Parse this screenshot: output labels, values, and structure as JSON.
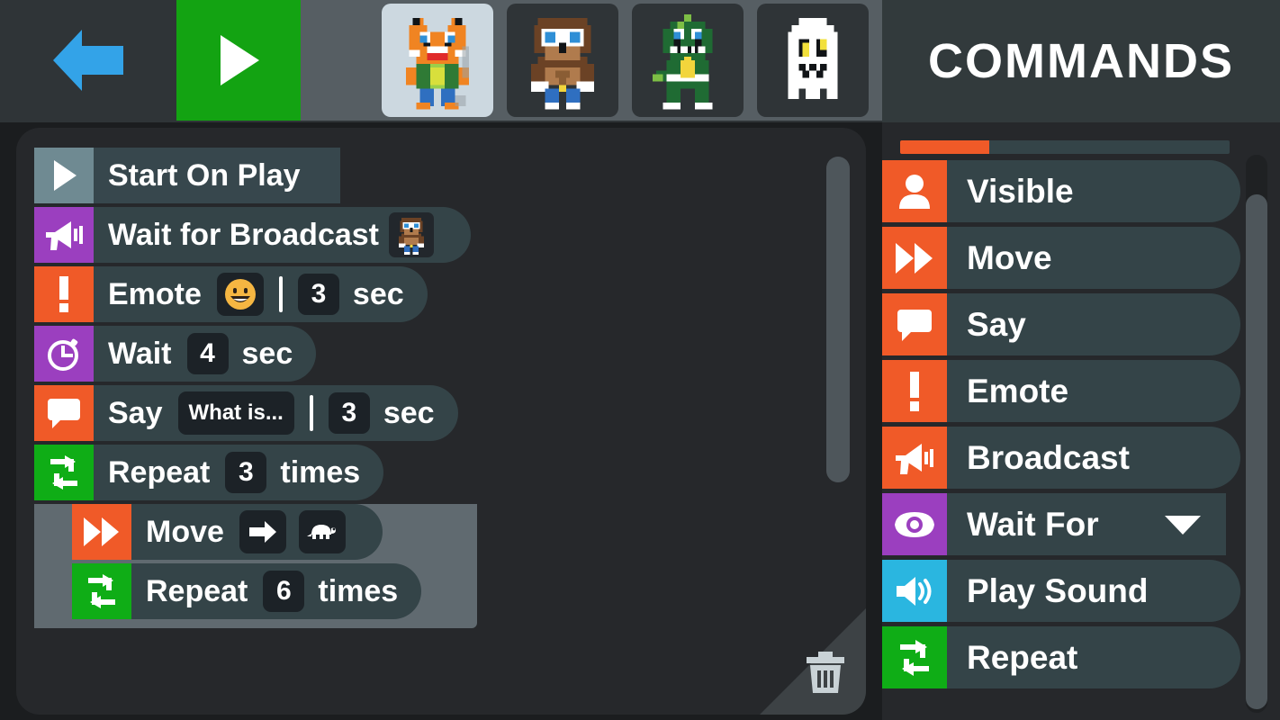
{
  "topbar": {
    "back_label": "Back",
    "back_icon": "left-arrow-icon",
    "play_label": "Play",
    "play_icon": "play-triangle-icon",
    "accent_green": "#13a312",
    "accent_blue": "#33a3e8",
    "actors": [
      {
        "name": "Fox",
        "icon": "fox-sprite",
        "selected": true
      },
      {
        "name": "Dog",
        "icon": "dog-sprite",
        "selected": false
      },
      {
        "name": "Dino",
        "icon": "dino-sprite",
        "selected": false
      },
      {
        "name": "Ghost",
        "icon": "ghost-sprite",
        "selected": false
      }
    ]
  },
  "commands_panel": {
    "title": "COMMANDS",
    "category_indicator": {
      "filled_percent": 27,
      "fill_color": "#f05a28",
      "track_color": "#344448"
    },
    "items": [
      {
        "label": "Visible",
        "icon": "person-icon",
        "color": "#f05a28",
        "has_caret": false
      },
      {
        "label": "Move",
        "icon": "fast-forward-icon",
        "color": "#f05a28",
        "has_caret": false
      },
      {
        "label": "Say",
        "icon": "speech-bubble-icon",
        "color": "#f05a28",
        "has_caret": false
      },
      {
        "label": "Emote",
        "icon": "exclamation-icon",
        "color": "#f05a28",
        "has_caret": false
      },
      {
        "label": "Broadcast",
        "icon": "megaphone-icon",
        "color": "#f05a28",
        "has_caret": false
      },
      {
        "label": "Wait For",
        "icon": "eye-icon",
        "color": "#9b3fbf",
        "has_caret": true
      },
      {
        "label": "Play Sound",
        "icon": "speaker-icon",
        "color": "#2ab6e0",
        "has_caret": false
      },
      {
        "label": "Repeat",
        "icon": "loop-icon",
        "color": "#0fad16",
        "has_caret": false
      }
    ],
    "caret_icon": "chevron-down-icon"
  },
  "script": {
    "trash_icon": "trash-icon",
    "blocks": [
      {
        "type": "hat",
        "label": "Start On Play",
        "icon": "play-triangle-icon",
        "color": "#6f8a92",
        "indent": 0,
        "fields": []
      },
      {
        "type": "command",
        "label": "Wait for Broadcast",
        "icon": "megaphone-icon",
        "color": "#9b3fbf",
        "indent": 0,
        "fields": [
          {
            "kind": "avatar",
            "value": "dog-sprite"
          }
        ]
      },
      {
        "type": "command",
        "label": "Emote",
        "icon": "exclamation-icon",
        "color": "#f05a28",
        "indent": 0,
        "fields": [
          {
            "kind": "emoji",
            "value": "grinning-face"
          },
          {
            "kind": "separator",
            "value": "|"
          },
          {
            "kind": "number",
            "value": "3"
          },
          {
            "kind": "unit",
            "value": "sec"
          }
        ]
      },
      {
        "type": "command",
        "label": "Wait",
        "icon": "stopwatch-icon",
        "color": "#9b3fbf",
        "indent": 0,
        "fields": [
          {
            "kind": "number",
            "value": "4"
          },
          {
            "kind": "unit",
            "value": "sec"
          }
        ]
      },
      {
        "type": "command",
        "label": "Say",
        "icon": "speech-bubble-icon",
        "color": "#f05a28",
        "indent": 0,
        "fields": [
          {
            "kind": "text",
            "value": "What is..."
          },
          {
            "kind": "separator",
            "value": "|"
          },
          {
            "kind": "number",
            "value": "3"
          },
          {
            "kind": "unit",
            "value": "sec"
          }
        ]
      },
      {
        "type": "c-block",
        "label": "Repeat",
        "icon": "loop-icon",
        "color": "#0fad16",
        "indent": 0,
        "fields": [
          {
            "kind": "number",
            "value": "3"
          },
          {
            "kind": "unit",
            "value": "times"
          }
        ]
      },
      {
        "type": "command",
        "label": "Move",
        "icon": "fast-forward-icon",
        "color": "#f05a28",
        "indent": 1,
        "fields": [
          {
            "kind": "icon",
            "value": "right-arrow-icon"
          },
          {
            "kind": "icon",
            "value": "turtle-icon"
          }
        ]
      },
      {
        "type": "c-block",
        "label": "Repeat",
        "icon": "loop-icon",
        "color": "#0fad16",
        "indent": 1,
        "fields": [
          {
            "kind": "number",
            "value": "6"
          },
          {
            "kind": "unit",
            "value": "times"
          }
        ]
      }
    ]
  }
}
